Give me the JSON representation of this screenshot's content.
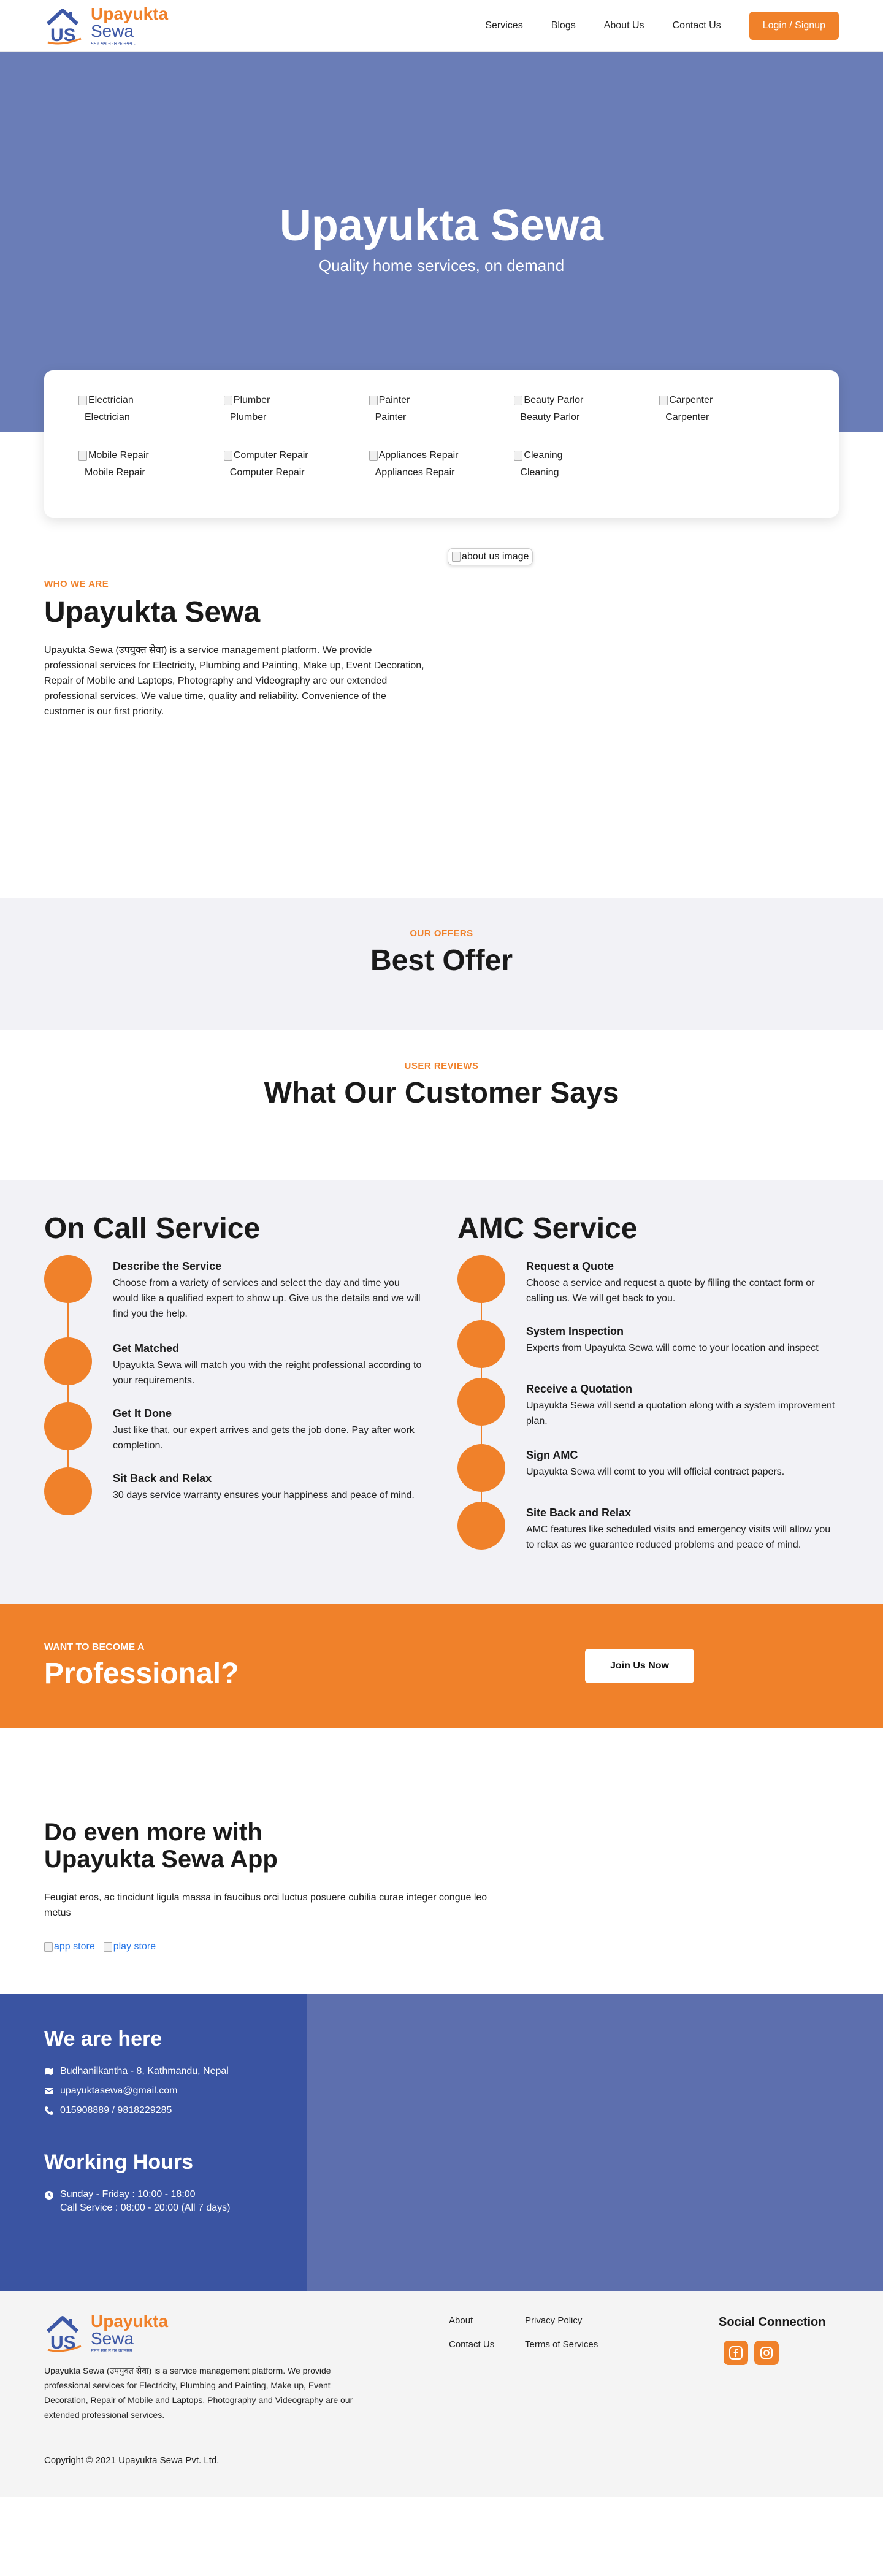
{
  "header": {
    "logo": {
      "mark": "US",
      "line1": "Upayukta",
      "line2": "Sewa",
      "tagline": "ममत मम म गर काममम ..."
    },
    "nav": [
      "Services",
      "Blogs",
      "About Us",
      "Contact Us"
    ],
    "login_label": "Login / Signup"
  },
  "hero": {
    "title": "Upayukta Sewa",
    "subtitle": "Quality home services, on demand"
  },
  "services": [
    {
      "alt": "Electrician",
      "label": "Electrician"
    },
    {
      "alt": "Plumber",
      "label": "Plumber"
    },
    {
      "alt": "Painter",
      "label": "Painter"
    },
    {
      "alt": "Beauty Parlor",
      "label": "Beauty Parlor"
    },
    {
      "alt": "Carpenter",
      "label": "Carpenter"
    },
    {
      "alt": "Mobile Repair",
      "label": "Mobile Repair"
    },
    {
      "alt": "Computer Repair",
      "label": "Computer Repair"
    },
    {
      "alt": "Appliances Repair",
      "label": "Appliances Repair"
    },
    {
      "alt": "Cleaning",
      "label": "Cleaning"
    }
  ],
  "about": {
    "image_alt": "about us image",
    "eyebrow": "WHO WE ARE",
    "title": "Upayukta Sewa",
    "body": "Upayukta Sewa (उपयुक्त सेवा) is a service management platform. We provide professional services for Electricity, Plumbing and Painting, Make up, Event Decoration, Repair of Mobile and Laptops, Photography and Videography are our extended professional services. We value time, quality and reliability. Convenience of the customer is our first priority."
  },
  "offer": {
    "eyebrow": "OUR OFFERS",
    "title": "Best Offer"
  },
  "reviews": {
    "eyebrow": "USER REVIEWS",
    "title": "What Our Customer Says"
  },
  "on_call": {
    "title": "On Call Service",
    "steps": [
      {
        "title": "Describe the Service",
        "text": "Choose from a variety of services and select the day and time you would like a qualified expert to show up. Give us the details and we will find you the help."
      },
      {
        "title": "Get Matched",
        "text": "Upayukta Sewa will match you with the reight professional according to your requirements."
      },
      {
        "title": "Get It Done",
        "text": "Just like that, our expert arrives and gets the job done. Pay after work completion."
      },
      {
        "title": "Sit Back and Relax",
        "text": "30 days service warranty ensures your happiness and peace of mind."
      }
    ]
  },
  "amc": {
    "title": "AMC Service",
    "steps": [
      {
        "title": "Request a Quote",
        "text": "Choose a service and request a quote by filling the contact form or calling us. We will get back to you."
      },
      {
        "title": "System Inspection",
        "text": "Experts from Upayukta Sewa will come to your location and inspect"
      },
      {
        "title": "Receive a Quotation",
        "text": "Upayukta Sewa will send a quotation along with a system improvement plan."
      },
      {
        "title": "Sign AMC",
        "text": "Upayukta Sewa will comt to you will official contract papers."
      },
      {
        "title": "Site Back and Relax",
        "text": "AMC features like scheduled visits and emergency visits will allow you to relax as we guarantee reduced problems and peace of mind."
      }
    ]
  },
  "pro": {
    "eyebrow": "WANT TO BECOME A",
    "title": "Professional?",
    "button": "Join Us Now"
  },
  "app": {
    "title_line1": "Do even more with",
    "title_line2": "Upayukta Sewa App",
    "text": "Feugiat eros, ac tincidunt ligula massa in faucibus orci luctus posuere cubilia curae integer congue leo metus",
    "app_store_alt": "app store",
    "play_store_alt": "play store"
  },
  "contact": {
    "title": "We are here",
    "address": "Budhanilkantha - 8, Kathmandu, Nepal",
    "email": "upayuktasewa@gmail.com",
    "phone": "015908889 / 9818229285",
    "hours_title": "Working Hours",
    "hours_line1": "Sunday - Friday : 10:00 - 18:00",
    "hours_line2": "Call Service : 08:00 - 20:00 (All 7 days)"
  },
  "footer": {
    "desc": "Upayukta Sewa (उपयुक्त सेवा) is a service management platform. We provide professional services for Electricity, Plumbing and Painting, Make up, Event Decoration, Repair of Mobile and Laptops, Photography and Videography are our extended professional services.",
    "links": [
      "About",
      "Privacy Policy",
      "Contact Us",
      "Terms of Services"
    ],
    "social_title": "Social Connection",
    "copyright": "Copyright © 2021 Upayukta Sewa Pvt. Ltd."
  },
  "colors": {
    "accent": "#f0812a",
    "hero": "#6a7db7",
    "contact_panel": "#3a54a2",
    "brand_blue": "#3d58a6"
  },
  "icons": [
    "logo-house-icon",
    "broken-image-icon",
    "map-icon",
    "mail-icon",
    "phone-icon",
    "clock-icon",
    "facebook-icon",
    "instagram-icon"
  ]
}
